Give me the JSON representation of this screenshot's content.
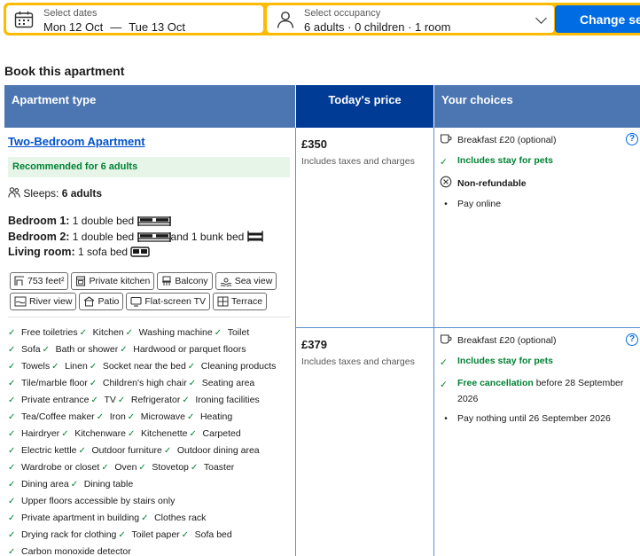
{
  "search": {
    "dates_label": "Select dates",
    "checkin": "Mon 12 Oct",
    "separator": "—",
    "checkout": "Tue 13 Oct",
    "occupancy_label": "Select occupancy",
    "occupancy_value": "6 adults · 0 children · 1 room",
    "button_label": "Change sear"
  },
  "section_title": "Book this apartment",
  "table_headers": {
    "type": "Apartment type",
    "price": "Today's price",
    "choices": "Your choices"
  },
  "apartment": {
    "name": "Two-Bedroom Apartment",
    "recommended": "Recommended for 6 adults",
    "sleeps_label": "Sleeps:",
    "sleeps_value": "6 adults",
    "bedrooms": [
      {
        "name": "Bedroom 1:",
        "text": "1 double bed"
      },
      {
        "name": "Bedroom 2:",
        "text": "1 double bed",
        "extra": "and 1 bunk bed"
      },
      {
        "name": "Living room:",
        "text": "1 sofa bed"
      }
    ],
    "tags_row1": [
      "753 feet²",
      "Private kitchen",
      "Balcony",
      "Sea view"
    ],
    "tags_row2": [
      "River view",
      "Patio",
      "Flat-screen TV",
      "Terrace"
    ],
    "facilities": [
      [
        "Free toiletries",
        "Kitchen",
        "Washing machine",
        "Toilet"
      ],
      [
        "Sofa",
        "Bath or shower",
        "Hardwood or parquet floors"
      ],
      [
        "Towels",
        "Linen",
        "Socket near the bed",
        "Cleaning products"
      ],
      [
        "Tile/marble floor",
        "Children's high chair",
        "Seating area"
      ],
      [
        "Private entrance",
        "TV",
        "Refrigerator",
        "Ironing facilities"
      ],
      [
        "Tea/Coffee maker",
        "Iron",
        "Microwave",
        "Heating"
      ],
      [
        "Hairdryer",
        "Kitchenware",
        "Kitchenette",
        "Carpeted"
      ],
      [
        "Electric kettle",
        "Outdoor furniture",
        "Outdoor dining area"
      ],
      [
        "Wardrobe or closet",
        "Oven",
        "Stovetop",
        "Toaster"
      ],
      [
        "Dining area",
        "Dining table"
      ],
      [
        "Upper floors accessible by stairs only"
      ],
      [
        "Private apartment in building",
        "Clothes rack"
      ],
      [
        "Drying rack for clothing",
        "Toilet paper",
        "Sofa bed"
      ],
      [
        "Carbon monoxide detector"
      ]
    ]
  },
  "options": [
    {
      "price": "£350",
      "price_note": "Includes taxes and charges",
      "breakfast": "Breakfast £20 (optional)",
      "pets": "Includes stay for pets",
      "policy": "Non-refundable",
      "payment": "Pay online"
    },
    {
      "price": "£379",
      "price_note": "Includes taxes and charges",
      "breakfast": "Breakfast £20 (optional)",
      "pets": "Includes stay for pets",
      "policy": "Free cancellation",
      "policy_rest_1": "before 28 September",
      "policy_rest_2": "2026",
      "payment": "Pay nothing until 26 September 2026"
    }
  ],
  "colors": {
    "brand_yellow": "#febb02",
    "header_blue": "#4c76b2",
    "price_header_blue": "#003b95",
    "button_blue": "#006ce4",
    "green": "#008234"
  }
}
